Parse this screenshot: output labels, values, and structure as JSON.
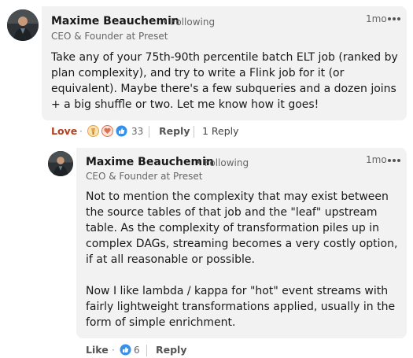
{
  "comment": {
    "author": "Maxime Beauchemin",
    "follow": "• Following",
    "headline": "CEO & Founder at Preset",
    "time": "1mo",
    "text": "Take any of your 75th-90th percentile batch ELT job (ranked by plan complexity), and try to write a Flink job for it (or equivalent). Maybe there's a few subqueries and a dozen joins + a big shuffle or two. Let me know how it goes!",
    "reaction_label": "Love",
    "reaction_count": "33",
    "reply_label": "Reply",
    "replies_count_label": "1 Reply",
    "colors": {
      "love": "#b24020",
      "like": "#378fe9",
      "heart": "#df704d",
      "celebrate": "#e7a33e"
    }
  },
  "reply": {
    "author": "Maxime Beauchemin",
    "follow": "• Following",
    "headline": "CEO & Founder at Preset",
    "time": "1mo",
    "paragraph1": "Not to mention the complexity that may exist between the source tables of that job and the \"leaf\" upstream table. As the complexity of transformation piles up in complex DAGs, streaming becomes a very costly option, if at all reasonable or possible.",
    "paragraph2": "Now I like lambda / kappa for \"hot\" event streams with fairly lightweight transformations applied, usually in the form of simple enrichment.",
    "like_label": "Like",
    "reaction_count": "6",
    "reply_label": "Reply"
  },
  "icons": [
    "avatar-photo",
    "more-dots-icon",
    "celebrate-icon",
    "love-icon",
    "like-icon"
  ]
}
